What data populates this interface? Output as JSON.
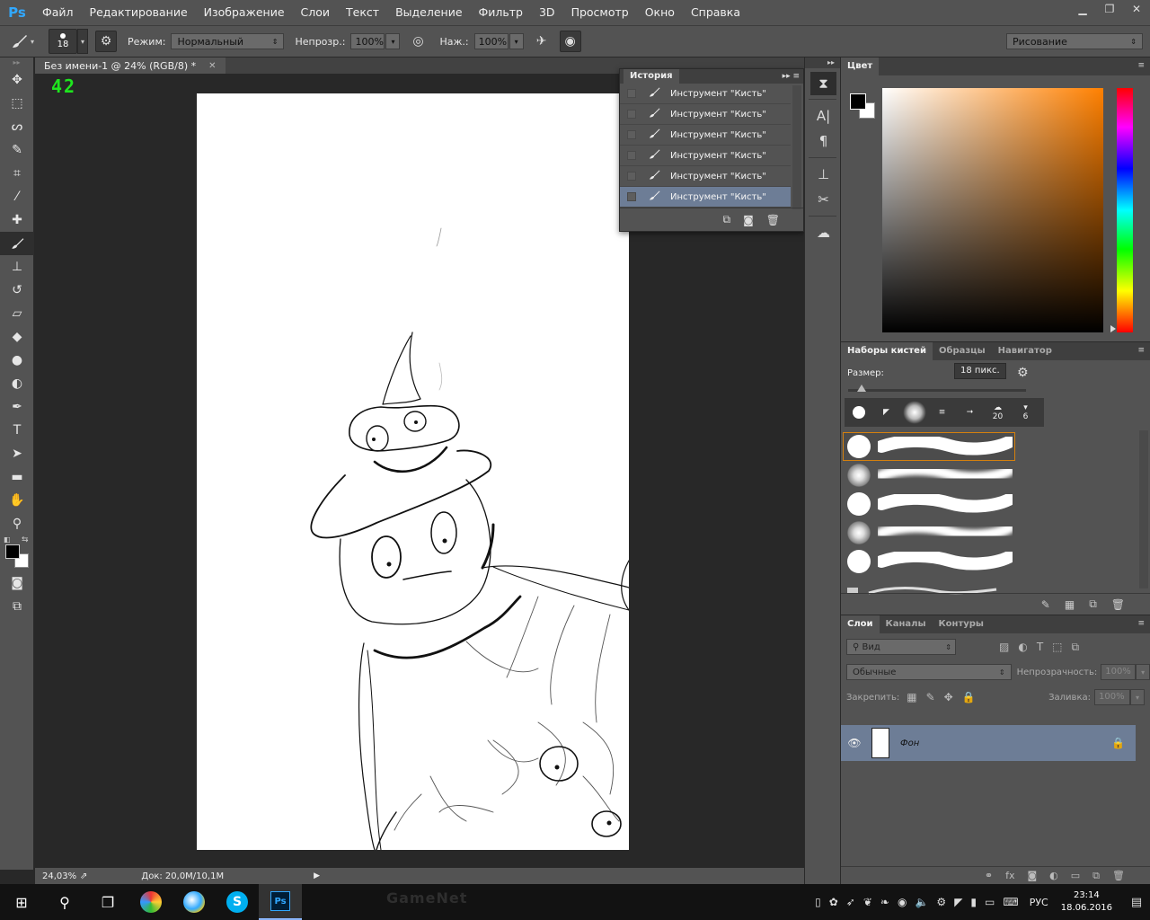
{
  "app": {
    "logo": "Ps",
    "menu": [
      "Файл",
      "Редактирование",
      "Изображение",
      "Слои",
      "Текст",
      "Выделение",
      "Фильтр",
      "3D",
      "Просмотр",
      "Окно",
      "Справка"
    ]
  },
  "options": {
    "brush_size": "18",
    "mode_label": "Режим:",
    "mode_value": "Нормальный",
    "opacity_label": "Непрозр.:",
    "opacity_value": "100%",
    "pressure_label": "Наж.:",
    "pressure_value": "100%",
    "workspace": "Рисование"
  },
  "document": {
    "tab_title": "Без имени-1 @ 24% (RGB/8) *",
    "fps_overlay": "42",
    "zoom": "24,03%",
    "doc_size": "Док: 20,0M/10,1M"
  },
  "history": {
    "title": "История",
    "items": [
      {
        "label": "Инструмент \"Кисть\""
      },
      {
        "label": "Инструмент \"Кисть\""
      },
      {
        "label": "Инструмент \"Кисть\""
      },
      {
        "label": "Инструмент \"Кисть\""
      },
      {
        "label": "Инструмент \"Кисть\""
      },
      {
        "label": "Инструмент \"Кисть\""
      }
    ],
    "selected_index": 5
  },
  "color_panel": {
    "tab": "Цвет",
    "foreground": "#000000",
    "background": "#ffffff",
    "hue_color": "#ff8000"
  },
  "brush_panel": {
    "tabs": [
      "Наборы кистей",
      "Образцы",
      "Навигатор"
    ],
    "size_label": "Размер:",
    "size_value": "18 пикс.",
    "tip_counts": [
      "20",
      "6"
    ]
  },
  "layers_panel": {
    "tabs": [
      "Слои",
      "Каналы",
      "Контуры"
    ],
    "filter_placeholder": "Вид",
    "blend_mode": "Обычные",
    "opacity_label": "Непрозрачность:",
    "opacity_value": "100%",
    "lock_label": "Закрепить:",
    "fill_label": "Заливка:",
    "fill_value": "100%",
    "layer_name": "Фон"
  },
  "taskbar": {
    "lang": "РУС",
    "time": "23:14",
    "date": "18.06.2016",
    "bg_text": "GameNet"
  },
  "colors": {
    "accent": "#31a8ff",
    "selection": "#6d7d96",
    "fps_green": "#1ee61e",
    "brush_highlight": "#d4800e"
  }
}
